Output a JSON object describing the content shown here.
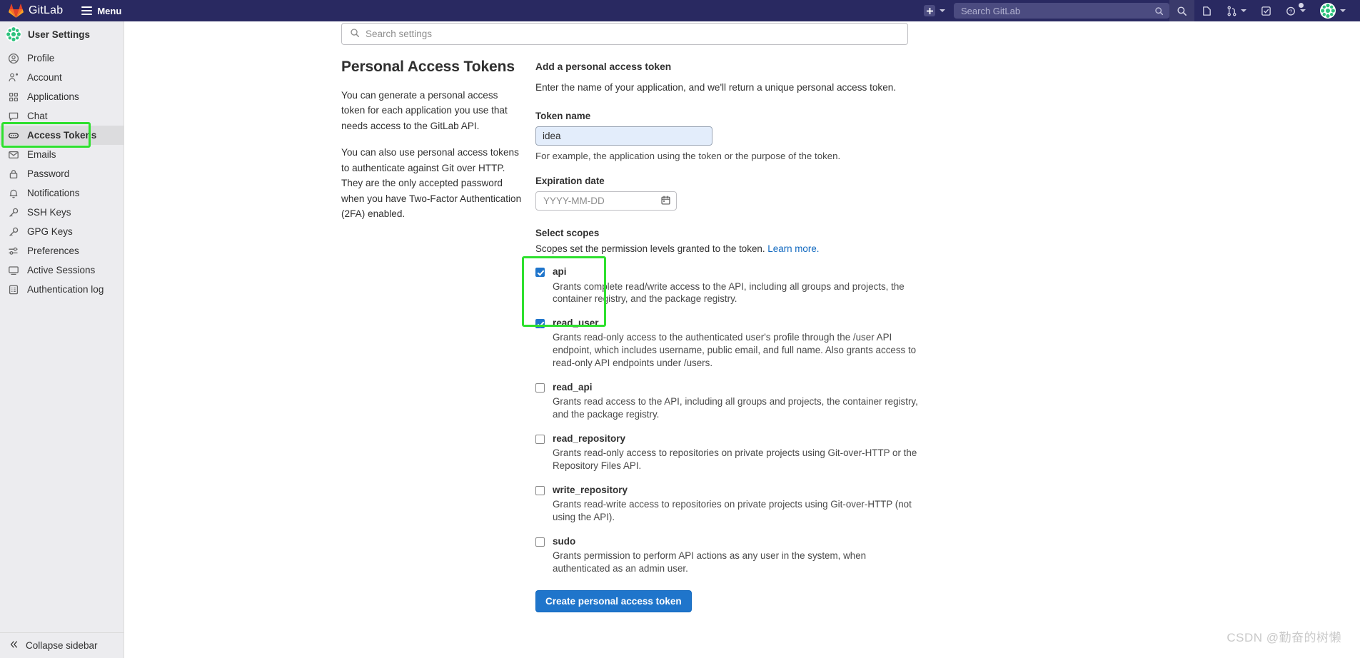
{
  "navbar": {
    "brand": "GitLab",
    "menu_label": "Menu",
    "new_dropdown_icon": "plus-square-icon",
    "search_placeholder": "Search GitLab",
    "icons": [
      {
        "name": "search-icon",
        "label": "Search"
      },
      {
        "name": "issues-icon",
        "label": "Issues"
      },
      {
        "name": "merge-requests-icon",
        "label": "Merge requests"
      },
      {
        "name": "todos-icon",
        "label": "To-Do List"
      },
      {
        "name": "help-icon",
        "label": "Help"
      },
      {
        "name": "user-avatar",
        "label": "User menu"
      }
    ]
  },
  "sidebar": {
    "title": "User Settings",
    "items": [
      {
        "label": "Profile",
        "icon": "user-circle-icon",
        "active": false
      },
      {
        "label": "Account",
        "icon": "account-icon",
        "active": false
      },
      {
        "label": "Applications",
        "icon": "applications-grid-icon",
        "active": false
      },
      {
        "label": "Chat",
        "icon": "chat-bubble-icon",
        "active": false
      },
      {
        "label": "Access Tokens",
        "icon": "token-icon",
        "active": true
      },
      {
        "label": "Emails",
        "icon": "envelope-icon",
        "active": false
      },
      {
        "label": "Password",
        "icon": "lock-icon",
        "active": false
      },
      {
        "label": "Notifications",
        "icon": "bell-icon",
        "active": false
      },
      {
        "label": "SSH Keys",
        "icon": "key-icon",
        "active": false
      },
      {
        "label": "GPG Keys",
        "icon": "key-icon",
        "active": false
      },
      {
        "label": "Preferences",
        "icon": "sliders-icon",
        "active": false
      },
      {
        "label": "Active Sessions",
        "icon": "monitor-icon",
        "active": false
      },
      {
        "label": "Authentication log",
        "icon": "log-list-icon",
        "active": false
      }
    ],
    "collapse_label": "Collapse sidebar"
  },
  "settings_search": {
    "placeholder": "Search settings",
    "icon": "search-icon"
  },
  "overview": {
    "title": "Personal Access Tokens",
    "paragraph1": "You can generate a personal access token for each application you use that needs access to the GitLab API.",
    "paragraph2": "You can also use personal access tokens to authenticate against Git over HTTP. They are the only accepted password when you have Two-Factor Authentication (2FA) enabled."
  },
  "form": {
    "section_title": "Add a personal access token",
    "lead": "Enter the name of your application, and we'll return a unique personal access token.",
    "token_name_label": "Token name",
    "token_name_value": "idea",
    "token_name_help": "For example, the application using the token or the purpose of the token.",
    "expiration_label": "Expiration date",
    "expiration_placeholder": "YYYY-MM-DD",
    "expiration_icon": "calendar-icon",
    "scopes_label": "Select scopes",
    "scopes_note": "Scopes set the permission levels granted to the token.",
    "scopes_link": "Learn more.",
    "submit_label": "Create personal access token",
    "scopes": [
      {
        "name": "api",
        "checked": true,
        "desc": "Grants complete read/write access to the API, including all groups and projects, the container registry, and the package registry."
      },
      {
        "name": "read_user",
        "checked": true,
        "desc": "Grants read-only access to the authenticated user's profile through the /user API endpoint, which includes username, public email, and full name. Also grants access to read-only API endpoints under /users."
      },
      {
        "name": "read_api",
        "checked": false,
        "desc": "Grants read access to the API, including all groups and projects, the container registry, and the package registry."
      },
      {
        "name": "read_repository",
        "checked": false,
        "desc": "Grants read-only access to repositories on private projects using Git-over-HTTP or the Repository Files API."
      },
      {
        "name": "write_repository",
        "checked": false,
        "desc": "Grants read-write access to repositories on private projects using Git-over-HTTP (not using the API)."
      },
      {
        "name": "sudo",
        "checked": false,
        "desc": "Grants permission to perform API actions as any user in the system, when authenticated as an admin user."
      }
    ]
  },
  "annotations": {
    "color": "#2ee02e",
    "boxes": [
      "sidebar-access-tokens",
      "scopes-api-and-read-user"
    ]
  },
  "watermark": "CSDN @勤奋的树懒"
}
